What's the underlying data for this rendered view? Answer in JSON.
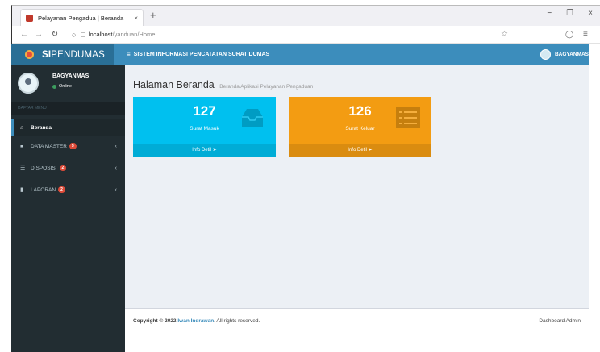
{
  "browser": {
    "tab_title": "Pelayanan Pengadua | Beranda",
    "tab_close": "×",
    "new_tab": "+",
    "url_host": "localhost",
    "url_path": "/yanduan/Home"
  },
  "app": {
    "logo_bold": "SI",
    "logo_rest": "PENDUMAS",
    "menu_toggle": "≡",
    "header_title": "SISTEM INFORMASI PENCATATAN SURAT DUMAS",
    "header_user": "BAGYANMAS"
  },
  "sidebar": {
    "user_name": "BAGYANMAS",
    "user_status": "Online",
    "menu_header": "DAFTAR MENU",
    "items": [
      {
        "label": "Beranda",
        "icon": "home-icon",
        "badge": null
      },
      {
        "label": "DATA MASTER",
        "icon": "file-icon",
        "badge": "5"
      },
      {
        "label": "DISPOSISI",
        "icon": "list-icon",
        "badge": "2"
      },
      {
        "label": "LAPORAN",
        "icon": "book-icon",
        "badge": "2"
      }
    ]
  },
  "content": {
    "title": "Halaman Beranda",
    "subtitle": "Beranda Aplikasi Pelayanan Pengaduan",
    "boxes": [
      {
        "number": "127",
        "label": "Surat Masuk",
        "footer": "Info Detil",
        "color": "#00c0ef",
        "icon": "inbox-icon"
      },
      {
        "number": "126",
        "label": "Surat Keluar",
        "footer": "Info Detil",
        "color": "#f39c12",
        "icon": "list-icon"
      }
    ]
  },
  "footer": {
    "copyright_prefix": "Copyright © 2022",
    "author": "Iwan Indrawan",
    "copyright_suffix": ". All rights reserved.",
    "right_text": "Dashboard Admin"
  },
  "colors": {
    "topbar": "#3c8dbc",
    "logo_bg": "#2a6f96",
    "sidebar": "#222d32",
    "content_bg": "#ecf0f5",
    "badge": "#dd4b39"
  }
}
